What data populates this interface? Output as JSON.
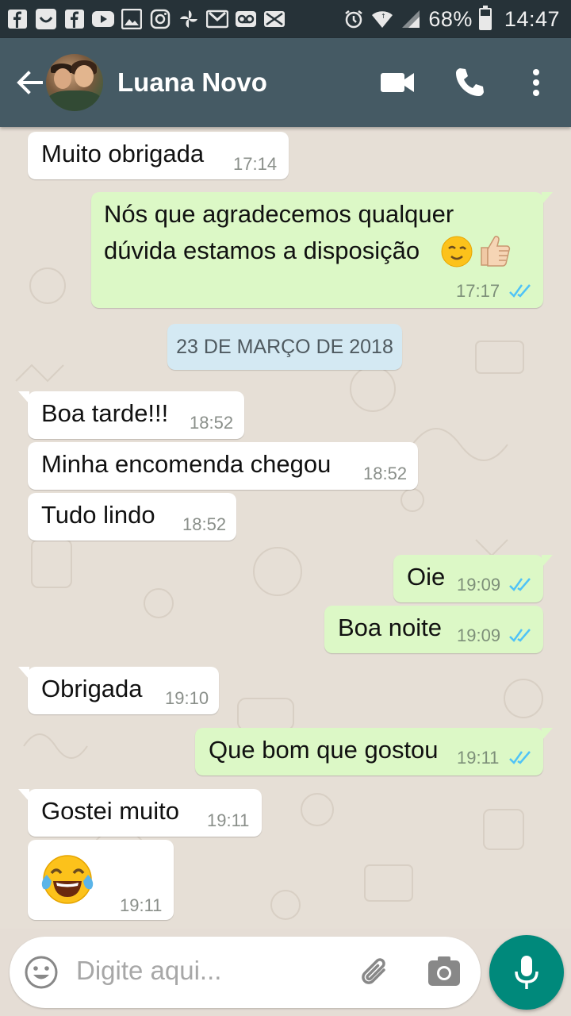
{
  "status_bar": {
    "battery": "68%",
    "battery_level": 0.68,
    "time": "14:47",
    "icons": [
      "facebook-icon",
      "smile-box-icon",
      "facebook-icon",
      "youtube-icon",
      "gallery-icon",
      "instagram-icon",
      "pinwheel-icon",
      "gmail-icon",
      "voicemail-icon",
      "mail-icon",
      "alarm-icon",
      "wifi-icon",
      "signal-icon",
      "battery-icon"
    ]
  },
  "header": {
    "contact_name": "Luana Novo",
    "icons": [
      "back-arrow-icon",
      "video-call-icon",
      "phone-icon",
      "more-vert-icon"
    ]
  },
  "messages": [
    {
      "dir": "in",
      "text": "Muito obrigada",
      "time": "17:14"
    },
    {
      "dir": "out",
      "text_line1": "Nós que agradecemos qualquer",
      "text_line2": "dúvida estamos a disposição",
      "emojis": [
        "wink-smile-emoji",
        "thumbs-up-emoji"
      ],
      "time": "17:17",
      "read": true
    },
    {
      "type": "date",
      "text": "23 DE MARÇO DE 2018"
    },
    {
      "dir": "in",
      "text": "Boa tarde!!!",
      "time": "18:52"
    },
    {
      "dir": "in",
      "text": "Minha encomenda chegou",
      "time": "18:52"
    },
    {
      "dir": "in",
      "text": "Tudo lindo",
      "time": "18:52"
    },
    {
      "dir": "out",
      "text": "Oie",
      "time": "19:09",
      "read": true
    },
    {
      "dir": "out",
      "text": "Boa noite",
      "time": "19:09",
      "read": true
    },
    {
      "dir": "in",
      "text": "Obrigada",
      "time": "19:10"
    },
    {
      "dir": "out",
      "text": "Que bom que gostou",
      "time": "19:11",
      "read": true
    },
    {
      "dir": "in",
      "text": "Gostei muito",
      "time": "19:11"
    },
    {
      "dir": "in",
      "emoji": "tears-of-joy-emoji",
      "time": "19:11"
    }
  ],
  "composer": {
    "placeholder": "Digite aqui...",
    "icons": [
      "emoji-icon",
      "attach-icon",
      "camera-icon",
      "mic-icon"
    ]
  },
  "colors": {
    "status_bar": "#263238",
    "app_bar": "#455a64",
    "outgoing_bubble": "#dcf8c6",
    "incoming_bubble": "#ffffff",
    "date_chip": "#d4e9f3",
    "read_ticks": "#4fc3f7",
    "mic_button": "#00897b",
    "chat_background": "#e5ddd5"
  }
}
